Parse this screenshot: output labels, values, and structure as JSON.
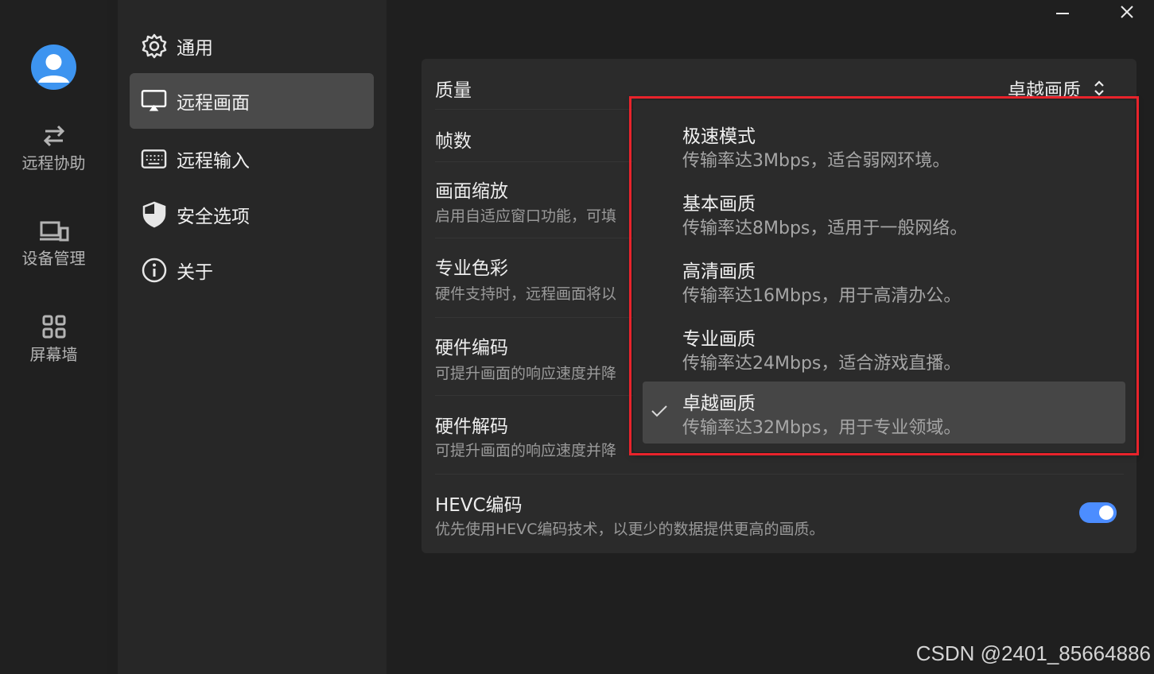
{
  "window": {
    "minimize_icon": "minimize-icon",
    "close_icon": "close-icon"
  },
  "rail": {
    "avatar_icon": "user-avatar-icon",
    "items": [
      {
        "label": "远程协助",
        "icon": "swap-arrows-icon"
      },
      {
        "label": "设备管理",
        "icon": "devices-icon"
      },
      {
        "label": "屏幕墙",
        "icon": "grid-icon"
      }
    ]
  },
  "menu": {
    "items": [
      {
        "label": "通用",
        "icon": "gear-icon",
        "active": false
      },
      {
        "label": "远程画面",
        "icon": "monitor-icon",
        "active": true
      },
      {
        "label": "远程输入",
        "icon": "keyboard-icon",
        "active": false
      },
      {
        "label": "安全选项",
        "icon": "shield-icon",
        "active": false
      },
      {
        "label": "关于",
        "icon": "info-icon",
        "active": false
      }
    ]
  },
  "settings": {
    "quality": {
      "title": "质量",
      "value": "卓越画质"
    },
    "fps": {
      "title": "帧数"
    },
    "scaling": {
      "title": "画面缩放",
      "desc": "启用自适应窗口功能，可填"
    },
    "color": {
      "title": "专业色彩",
      "desc": "硬件支持时，远程画面将以"
    },
    "hw_encode": {
      "title": "硬件编码",
      "desc": "可提升画面的响应速度并降"
    },
    "hw_decode": {
      "title": "硬件解码",
      "desc": "可提升画面的响应速度并降"
    },
    "hevc": {
      "title": "HEVC编码",
      "desc": "优先使用HEVC编码技术，以更少的数据提供更高的画质。",
      "enabled": true
    }
  },
  "dropdown": {
    "options": [
      {
        "title": "极速模式",
        "desc": "传输率达3Mbps，适合弱网环境。",
        "selected": false
      },
      {
        "title": "基本画质",
        "desc": "传输率达8Mbps，适用于一般网络。",
        "selected": false
      },
      {
        "title": "高清画质",
        "desc": "传输率达16Mbps，用于高清办公。",
        "selected": false
      },
      {
        "title": "专业画质",
        "desc": "传输率达24Mbps，适合游戏直播。",
        "selected": false
      },
      {
        "title": "卓越画质",
        "desc": "传输率达32Mbps，用于专业领域。",
        "selected": true
      }
    ]
  },
  "colors": {
    "accent": "#4c8dff",
    "highlight_border": "#e8232b",
    "avatar": "#3d94f0"
  },
  "watermark": "CSDN @2401_85664886"
}
